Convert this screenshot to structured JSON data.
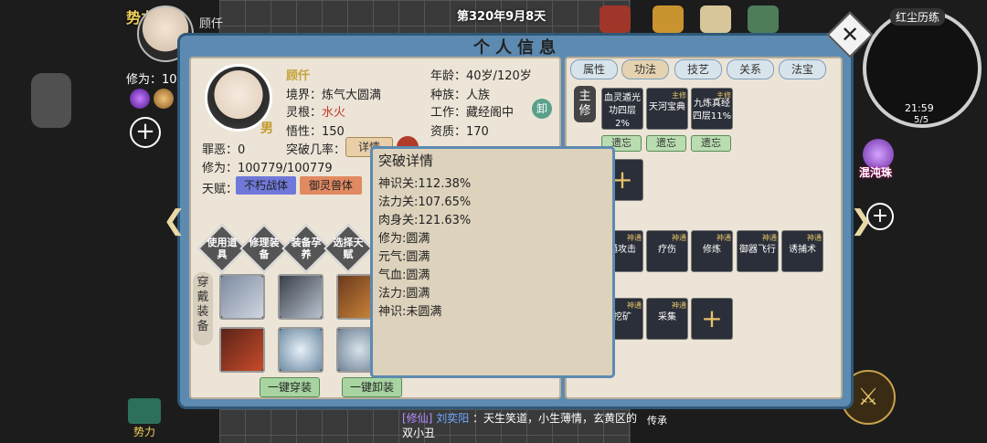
{
  "hud": {
    "faction": "势力",
    "player_name": "顾仟",
    "xiuwei_short": "修为：10",
    "date": "第320年9月8天",
    "minimap_title": "红尘历练",
    "minimap_time": "21:59",
    "minimap_count": "5/5",
    "pearl_label": "混沌珠",
    "chat_tag": "[修仙]",
    "chat_user": "刘奕阳",
    "chat_text": "：天生笑道，小生薄情，玄黄区的双小丑",
    "bottom_left_label": "势力",
    "bottom_right_label": "传承"
  },
  "panel": {
    "title": "个人信息",
    "name": "顾仟",
    "gender": "男",
    "realm_label": "境界：",
    "realm": "炼气大圆满",
    "root_label": "灵根：",
    "root": "水火",
    "insight_label": "悟性：",
    "insight": "150",
    "sin_label": "罪恶：",
    "sin": "0",
    "break_label": "突破几率：",
    "detail_btn": "详情",
    "xiuwei_label": "修为：",
    "xiuwei": "100779/100779",
    "talent_label": "天赋：",
    "talents": [
      "不朽战体",
      "御灵兽体"
    ],
    "age_label": "年龄：",
    "age": "40岁/120岁",
    "race_label": "种族：",
    "race": "人族",
    "job_label": "工作：",
    "job": "藏经阁中",
    "job_btn": "卸",
    "aptitude_label": "资质：",
    "aptitude": "170",
    "actions": [
      "使用道具",
      "修理装备",
      "装备孕养",
      "选择天赋"
    ],
    "equip_label": "穿戴装备",
    "btn_wear_all": "一键穿装",
    "btn_remove_all": "一键卸装"
  },
  "tabs": [
    "属性",
    "功法",
    "技艺",
    "关系",
    "法宝"
  ],
  "active_tab": "功法",
  "skills": {
    "main_label": "主修",
    "main": [
      {
        "name": "血灵遁光",
        "sub": "功四层",
        "pct": "2%",
        "badge": ""
      },
      {
        "name": "天河宝典",
        "sub": "",
        "pct": "",
        "badge": "主修"
      },
      {
        "name": "九炼真经",
        "sub": "四层11%",
        "pct": "",
        "badge": "主修"
      }
    ],
    "forget": [
      "遗忘",
      "遗忘",
      "遗忘"
    ],
    "row2": [
      {
        "name": "通攻击",
        "badge": "神通"
      },
      {
        "name": "疗伤",
        "badge": "神通"
      },
      {
        "name": "修炼",
        "badge": "神通"
      },
      {
        "name": "御器飞行",
        "badge": "神通"
      },
      {
        "name": "诱捕术",
        "badge": "神通"
      }
    ],
    "row3": [
      {
        "name": "挖矿",
        "badge": "神通"
      },
      {
        "name": "采集",
        "badge": "神通"
      }
    ]
  },
  "tooltip": {
    "title": "突破详情",
    "lines": [
      "神识关:112.38%",
      "法力关:107.65%",
      "肉身关:121.63%",
      "修为:圆满",
      "元气:圆满",
      "气血:圆满",
      "法力:圆满",
      "神识:未圆满"
    ]
  },
  "icons": {
    "close": "close-icon",
    "left_arrow": "chevron-left-icon",
    "right_arrow": "chevron-right-icon",
    "plus": "plus-icon",
    "sword": "sword-icon"
  }
}
